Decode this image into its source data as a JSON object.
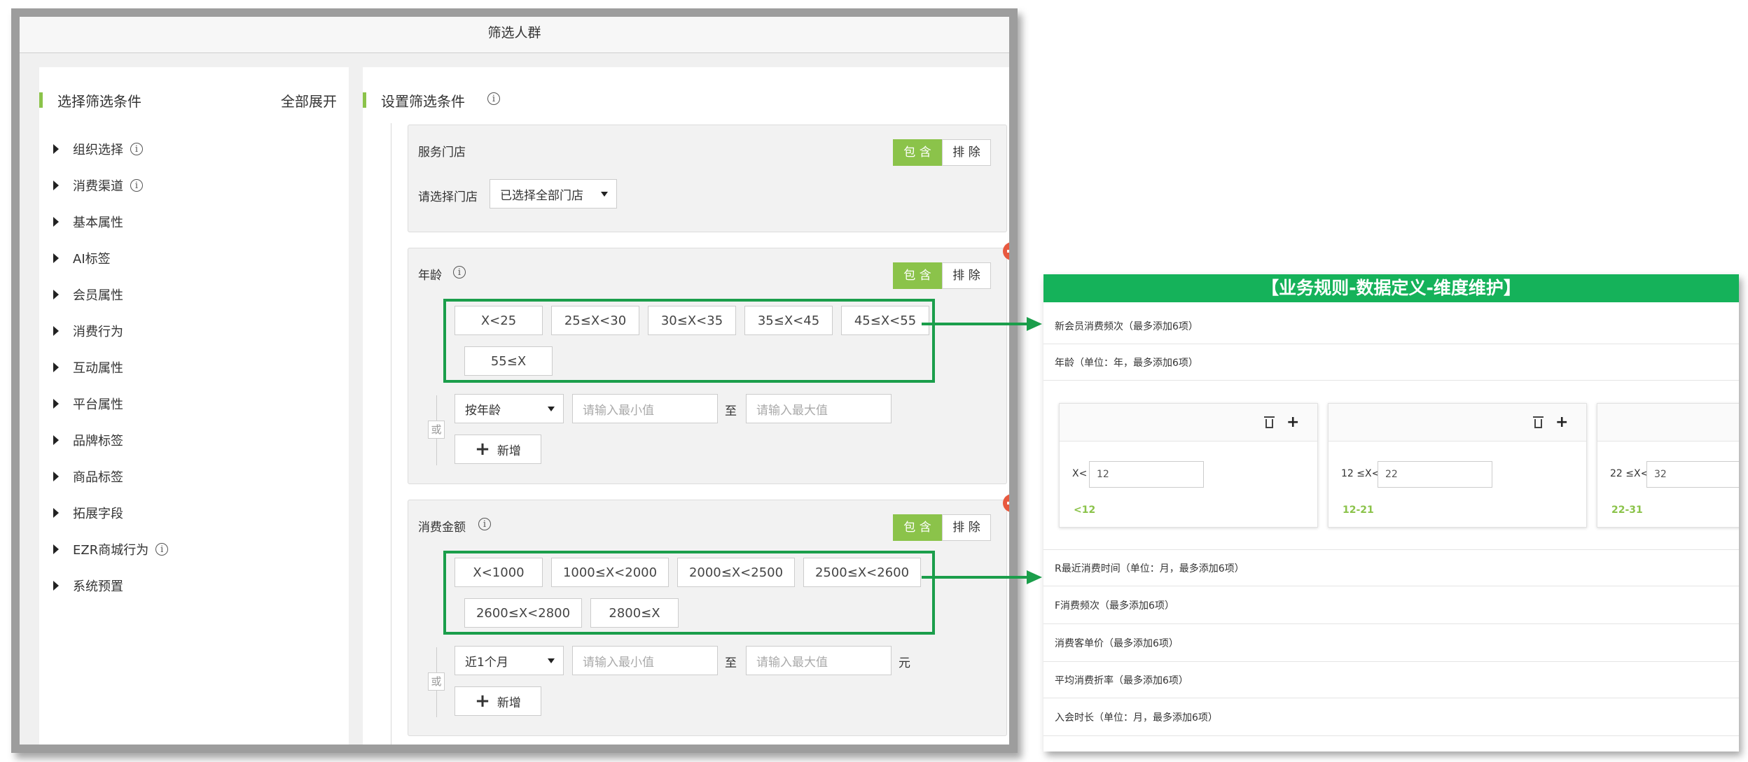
{
  "window": {
    "title": "筛选人群"
  },
  "left_panel": {
    "title": "选择筛选条件",
    "expand_all": "全部展开",
    "items": [
      {
        "label": "组织选择",
        "info": true
      },
      {
        "label": "消费渠道",
        "info": true
      },
      {
        "label": "基本属性",
        "info": false
      },
      {
        "label": "AI标签",
        "info": false
      },
      {
        "label": "会员属性",
        "info": false
      },
      {
        "label": "消费行为",
        "info": false
      },
      {
        "label": "互动属性",
        "info": false
      },
      {
        "label": "平台属性",
        "info": false
      },
      {
        "label": "品牌标签",
        "info": false
      },
      {
        "label": "商品标签",
        "info": false
      },
      {
        "label": "拓展字段",
        "info": false
      },
      {
        "label": "EZR商城行为",
        "info": true
      },
      {
        "label": "系统预置",
        "info": false
      }
    ]
  },
  "main": {
    "title": "设置筛选条件",
    "include_label": "包 含",
    "exclude_label": "排 除",
    "or_label": "或",
    "add_label": "新增",
    "to_label": "至",
    "store_card": {
      "title": "服务门店",
      "select_label": "请选择门店",
      "select_value": "已选择全部门店"
    },
    "age_card": {
      "title": "年龄",
      "chips": [
        "X<25",
        "25≤X<30",
        "30≤X<35",
        "35≤X<45",
        "45≤X<55",
        "55≤X"
      ],
      "mode_value": "按年龄",
      "min_placeholder": "请输入最小值",
      "max_placeholder": "请输入最大值"
    },
    "amount_card": {
      "title": "消费金额",
      "chips": [
        "X<1000",
        "1000≤X<2000",
        "2000≤X<2500",
        "2500≤X<2600",
        "2600≤X<2800",
        "2800≤X"
      ],
      "period_value": "近1个月",
      "min_placeholder": "请输入最小值",
      "max_placeholder": "请输入最大值",
      "unit": "元"
    }
  },
  "rules_panel": {
    "header": "【业务规则-数据定义-维度维护】",
    "rows_top": [
      "新会员消费频次（最多添加6项）",
      "年龄（单位：年，最多添加6项）"
    ],
    "age_cards": [
      {
        "label": "X<",
        "value": "12",
        "range": "<12"
      },
      {
        "label": "12 ≤X<",
        "value": "22",
        "range": "12-21"
      },
      {
        "label": "22 ≤X<",
        "value": "32",
        "range": "22-31"
      }
    ],
    "rows_bottom": [
      "R最近消费时间（单位：月，最多添加6项）",
      "F消费频次（最多添加6项）",
      "消费客单价（最多添加6项）",
      "平均消费折率（最多添加6项）",
      "入会时长（单位：月，最多添加6项）"
    ]
  },
  "colors": {
    "accent_green": "#8bc34a",
    "box_green": "#1b9e4b",
    "header_green": "#15b25a",
    "remove_red": "#e8593f"
  }
}
